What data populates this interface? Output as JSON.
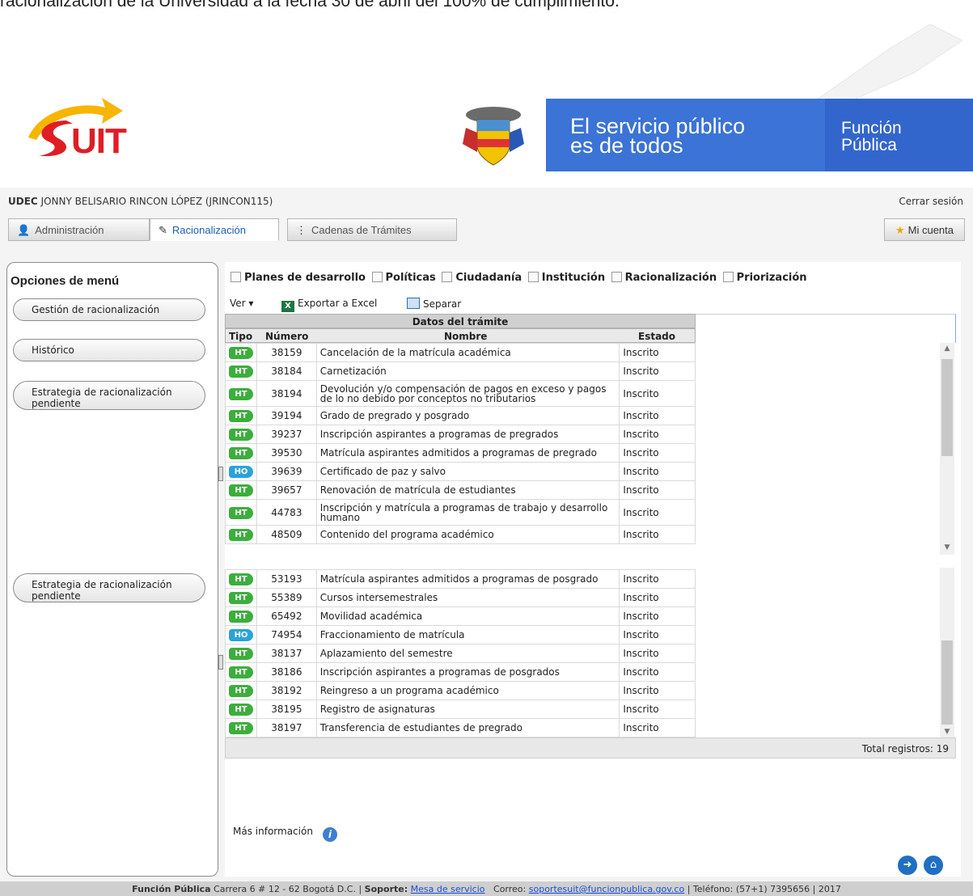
{
  "top_text": "racionalización de la Universidad a la fecha 30 de abril del 100% de cumplimiento.",
  "logo_text": "UIT",
  "banner": {
    "slogan": "El servicio público es de todos",
    "slogan_line1": "El servicio público",
    "slogan_line2": "es de todos",
    "entity_line1": "Función",
    "entity_line2": "Pública"
  },
  "user": {
    "org": "UDEC",
    "name": "JONNY BELISARIO RINCON LÓPEZ (JRINCON115)"
  },
  "logout_label": "Cerrar sesión",
  "tabs": [
    {
      "label": "Administración",
      "icon": "user-admin-icon"
    },
    {
      "label": "Racionalización",
      "icon": "edit-icon"
    },
    {
      "label": "Cadenas de Trámites",
      "icon": "tree-icon"
    }
  ],
  "account_label": "Mi cuenta",
  "sidebar": {
    "title": "Opciones de menú",
    "items": [
      {
        "label": "Gestión de racionalización"
      },
      {
        "label": "Histórico"
      },
      {
        "label": "Estrategia de racionalización pendiente"
      }
    ],
    "repeat_item": "Estrategia de racionalización pendiente"
  },
  "filters": [
    "Planes de desarrollo",
    "Políticas",
    "Ciudadanía",
    "Institución",
    "Racionalización",
    "Priorización"
  ],
  "toolbar": {
    "view_label": "Ver",
    "export_label": "Exportar a Excel",
    "split_label": "Separar"
  },
  "grid": {
    "group_header": "Datos del trámite",
    "columns": [
      "Tipo",
      "Número",
      "Nombre",
      "Estado"
    ],
    "rows_top": [
      {
        "tipo": "HT",
        "numero": "38159",
        "nombre": "Cancelación de la matrícula académica",
        "estado": "Inscrito"
      },
      {
        "tipo": "HT",
        "numero": "38184",
        "nombre": "Carnetización",
        "estado": "Inscrito"
      },
      {
        "tipo": "HT",
        "numero": "38194",
        "nombre": "Devolución y/o compensación de pagos en exceso y pagos de lo no debido por conceptos no tributarios",
        "estado": "Inscrito"
      },
      {
        "tipo": "HT",
        "numero": "39194",
        "nombre": "Grado de pregrado y posgrado",
        "estado": "Inscrito"
      },
      {
        "tipo": "HT",
        "numero": "39237",
        "nombre": "Inscripción aspirantes a programas de pregrados",
        "estado": "Inscrito"
      },
      {
        "tipo": "HT",
        "numero": "39530",
        "nombre": "Matrícula aspirantes admitidos a programas de pregrado",
        "estado": "Inscrito"
      },
      {
        "tipo": "HO",
        "numero": "39639",
        "nombre": "Certificado de paz y salvo",
        "estado": "Inscrito"
      },
      {
        "tipo": "HT",
        "numero": "39657",
        "nombre": "Renovación de matrícula de estudiantes",
        "estado": "Inscrito"
      },
      {
        "tipo": "HT",
        "numero": "44783",
        "nombre": "Inscripción y matrícula a programas de trabajo y desarrollo humano",
        "estado": "Inscrito"
      },
      {
        "tipo": "HT",
        "numero": "48509",
        "nombre": "Contenido del programa académico",
        "estado": "Inscrito"
      }
    ],
    "rows_bottom": [
      {
        "tipo": "HT",
        "numero": "53193",
        "nombre": "Matrícula aspirantes admitidos a programas de posgrado",
        "estado": "Inscrito"
      },
      {
        "tipo": "HT",
        "numero": "55389",
        "nombre": "Cursos intersemestrales",
        "estado": "Inscrito"
      },
      {
        "tipo": "HT",
        "numero": "65492",
        "nombre": "Movilidad académica",
        "estado": "Inscrito"
      },
      {
        "tipo": "HO",
        "numero": "74954",
        "nombre": "Fraccionamiento de matrícula",
        "estado": "Inscrito"
      },
      {
        "tipo": "HT",
        "numero": "38137",
        "nombre": "Aplazamiento del semestre",
        "estado": "Inscrito"
      },
      {
        "tipo": "HT",
        "numero": "38186",
        "nombre": "Inscripción aspirantes a programas de posgrados",
        "estado": "Inscrito"
      },
      {
        "tipo": "HT",
        "numero": "38192",
        "nombre": "Reingreso a un programa académico",
        "estado": "Inscrito"
      },
      {
        "tipo": "HT",
        "numero": "38195",
        "nombre": "Registro de asignaturas",
        "estado": "Inscrito"
      },
      {
        "tipo": "HT",
        "numero": "38197",
        "nombre": "Transferencia de estudiantes de pregrado",
        "estado": "Inscrito"
      }
    ],
    "total_label": "Total registros: 19"
  },
  "more_info_label": "Más información",
  "footer": {
    "org": "Función Pública",
    "address": "Carrera 6 # 12 - 62 Bogotá D.C. |",
    "support_label": "Soporte:",
    "support_link": "Mesa de servicio",
    "email_label": "Correo:",
    "email": "soportesuit@funcionpublica.gov.co",
    "tail": "| Teléfono: (57+1) 7395656 | 2017"
  }
}
